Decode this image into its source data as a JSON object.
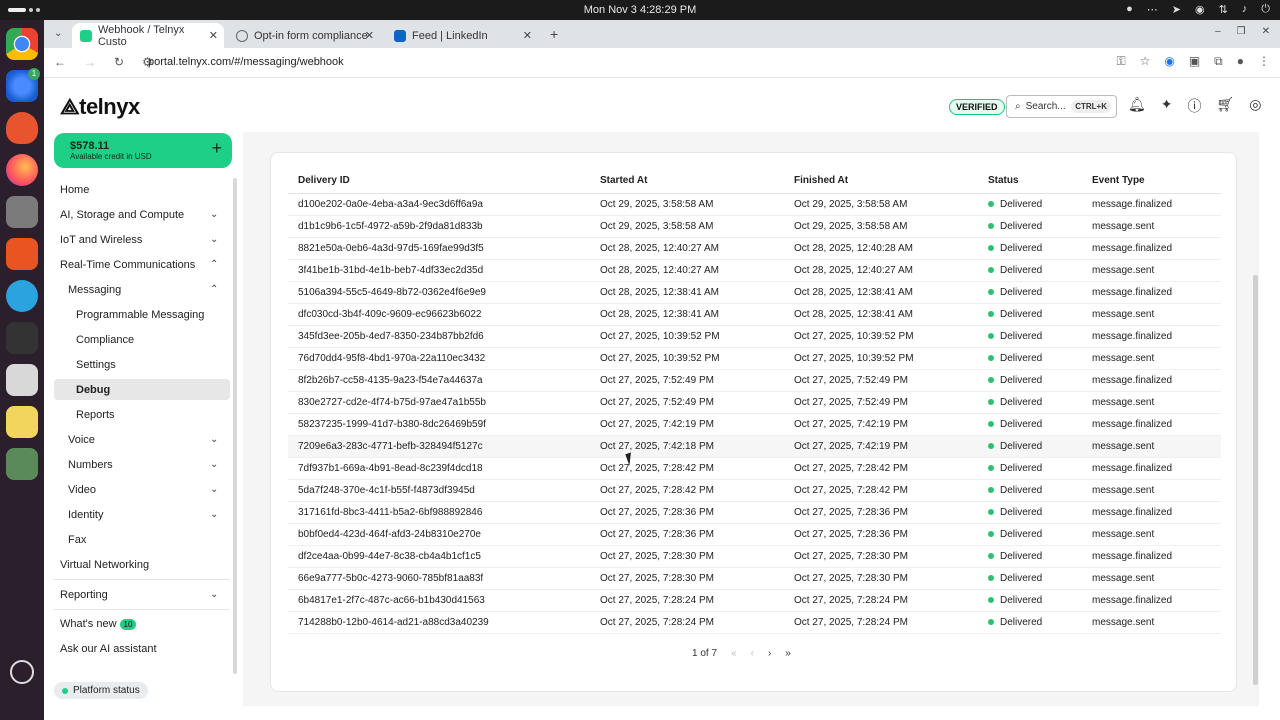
{
  "system": {
    "clock": "Mon Nov 3   4:28:29 PM"
  },
  "tabs": [
    {
      "label": "Webhook / Telnyx Custo",
      "active": true
    },
    {
      "label": "Opt-in form compliance",
      "active": false
    },
    {
      "label": "Feed | LinkedIn",
      "active": false
    }
  ],
  "address": {
    "url": "portal.telnyx.com/#/messaging/webhook"
  },
  "header": {
    "logo": "telnyx",
    "verified": "VERIFIED",
    "search_placeholder": "Search...",
    "search_shortcut": "CTRL+K"
  },
  "credit": {
    "amount": "$578.11",
    "label": "Available credit in USD"
  },
  "sidebar": {
    "home": "Home",
    "ai_storage": "AI, Storage and Compute",
    "iot": "IoT and Wireless",
    "rtc": "Real-Time Communications",
    "messaging": "Messaging",
    "programmable": "Programmable Messaging",
    "compliance": "Compliance",
    "settings": "Settings",
    "debug": "Debug",
    "reports": "Reports",
    "voice": "Voice",
    "numbers": "Numbers",
    "video": "Video",
    "identity": "Identity",
    "fax": "Fax",
    "vnet": "Virtual Networking",
    "reporting": "Reporting",
    "whats_new": "What's new",
    "whats_new_count": "10",
    "ask_ai": "Ask our AI assistant",
    "platform_status": "Platform status"
  },
  "table": {
    "columns": [
      "Delivery ID",
      "Started At",
      "Finished At",
      "Status",
      "Event Type"
    ],
    "rows": [
      [
        "d100e202-0a0e-4eba-a3a4-9ec3d6ff6a9a",
        "Oct 29, 2025, 3:58:58 AM",
        "Oct 29, 2025, 3:58:58 AM",
        "Delivered",
        "message.finalized"
      ],
      [
        "d1b1c9b6-1c5f-4972-a59b-2f9da81d833b",
        "Oct 29, 2025, 3:58:58 AM",
        "Oct 29, 2025, 3:58:58 AM",
        "Delivered",
        "message.sent"
      ],
      [
        "8821e50a-0eb6-4a3d-97d5-169fae99d3f5",
        "Oct 28, 2025, 12:40:27 AM",
        "Oct 28, 2025, 12:40:28 AM",
        "Delivered",
        "message.finalized"
      ],
      [
        "3f41be1b-31bd-4e1b-beb7-4df33ec2d35d",
        "Oct 28, 2025, 12:40:27 AM",
        "Oct 28, 2025, 12:40:27 AM",
        "Delivered",
        "message.sent"
      ],
      [
        "5106a394-55c5-4649-8b72-0362e4f6e9e9",
        "Oct 28, 2025, 12:38:41 AM",
        "Oct 28, 2025, 12:38:41 AM",
        "Delivered",
        "message.finalized"
      ],
      [
        "dfc030cd-3b4f-409c-9609-ec96623b6022",
        "Oct 28, 2025, 12:38:41 AM",
        "Oct 28, 2025, 12:38:41 AM",
        "Delivered",
        "message.sent"
      ],
      [
        "345fd3ee-205b-4ed7-8350-234b87bb2fd6",
        "Oct 27, 2025, 10:39:52 PM",
        "Oct 27, 2025, 10:39:52 PM",
        "Delivered",
        "message.finalized"
      ],
      [
        "76d70dd4-95f8-4bd1-970a-22a110ec3432",
        "Oct 27, 2025, 10:39:52 PM",
        "Oct 27, 2025, 10:39:52 PM",
        "Delivered",
        "message.sent"
      ],
      [
        "8f2b26b7-cc58-4135-9a23-f54e7a44637a",
        "Oct 27, 2025, 7:52:49 PM",
        "Oct 27, 2025, 7:52:49 PM",
        "Delivered",
        "message.finalized"
      ],
      [
        "830e2727-cd2e-4f74-b75d-97ae47a1b55b",
        "Oct 27, 2025, 7:52:49 PM",
        "Oct 27, 2025, 7:52:49 PM",
        "Delivered",
        "message.sent"
      ],
      [
        "58237235-1999-41d7-b380-8dc26469b59f",
        "Oct 27, 2025, 7:42:19 PM",
        "Oct 27, 2025, 7:42:19 PM",
        "Delivered",
        "message.finalized"
      ],
      [
        "7209e6a3-283c-4771-befb-328494f5127c",
        "Oct 27, 2025, 7:42:18 PM",
        "Oct 27, 2025, 7:42:19 PM",
        "Delivered",
        "message.sent"
      ],
      [
        "7df937b1-669a-4b91-8ead-8c239f4dcd18",
        "Oct 27, 2025, 7:28:42 PM",
        "Oct 27, 2025, 7:28:42 PM",
        "Delivered",
        "message.finalized"
      ],
      [
        "5da7f248-370e-4c1f-b55f-f4873df3945d",
        "Oct 27, 2025, 7:28:42 PM",
        "Oct 27, 2025, 7:28:42 PM",
        "Delivered",
        "message.sent"
      ],
      [
        "317161fd-8bc3-4411-b5a2-6bf988892846",
        "Oct 27, 2025, 7:28:36 PM",
        "Oct 27, 2025, 7:28:36 PM",
        "Delivered",
        "message.finalized"
      ],
      [
        "b0bf0ed4-423d-464f-afd3-24b8310e270e",
        "Oct 27, 2025, 7:28:36 PM",
        "Oct 27, 2025, 7:28:36 PM",
        "Delivered",
        "message.sent"
      ],
      [
        "df2ce4aa-0b99-44e7-8c38-cb4a4b1cf1c5",
        "Oct 27, 2025, 7:28:30 PM",
        "Oct 27, 2025, 7:28:30 PM",
        "Delivered",
        "message.finalized"
      ],
      [
        "66e9a777-5b0c-4273-9060-785bf81aa83f",
        "Oct 27, 2025, 7:28:30 PM",
        "Oct 27, 2025, 7:28:30 PM",
        "Delivered",
        "message.sent"
      ],
      [
        "6b4817e1-2f7c-487c-ac66-b1b430d41563",
        "Oct 27, 2025, 7:28:24 PM",
        "Oct 27, 2025, 7:28:24 PM",
        "Delivered",
        "message.finalized"
      ],
      [
        "714288b0-12b0-4614-ad21-a88cd3a40239",
        "Oct 27, 2025, 7:28:24 PM",
        "Oct 27, 2025, 7:28:24 PM",
        "Delivered",
        "message.sent"
      ]
    ]
  },
  "pager": {
    "label": "1 of 7"
  },
  "colors": {
    "accent": "#1ed087",
    "status_delivered": "#2fbf71"
  },
  "icons": [
    "search-icon",
    "bell-icon",
    "sparkle-icon",
    "help-icon",
    "cart-icon",
    "account-icon"
  ]
}
